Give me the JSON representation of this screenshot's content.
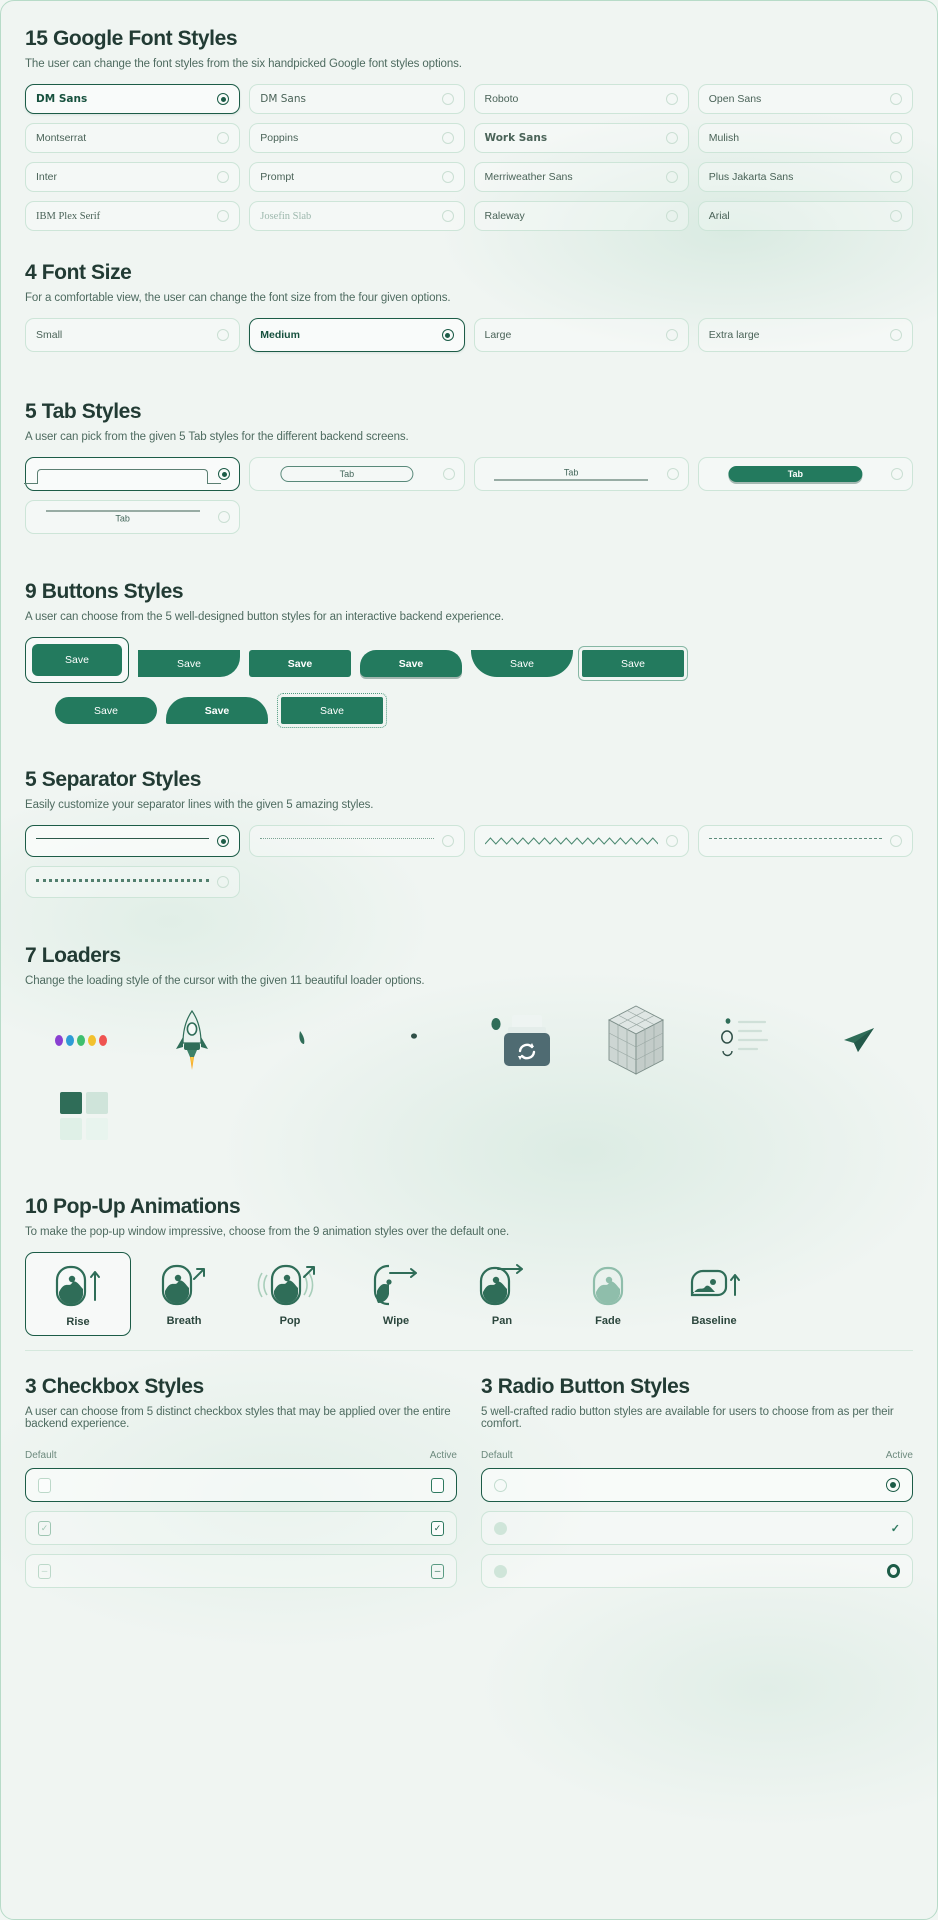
{
  "theme": {
    "accent": "#237a5e",
    "accent_dark": "#1c5c47",
    "bg": "#f0f5f2",
    "text": "#223b34"
  },
  "sections": {
    "fonts": {
      "title": "15 Google Font Styles",
      "subtitle": "The user can change the font styles from the six handpicked Google font styles options.",
      "options": [
        {
          "label": "DM Sans",
          "selected": true
        },
        {
          "label": "DM Sans",
          "selected": false
        },
        {
          "label": "Roboto",
          "selected": false
        },
        {
          "label": "Open Sans",
          "selected": false
        },
        {
          "label": "Montserrat",
          "selected": false
        },
        {
          "label": "Poppins",
          "selected": false
        },
        {
          "label": "Work Sans",
          "selected": false
        },
        {
          "label": "Mulish",
          "selected": false
        },
        {
          "label": "Inter",
          "selected": false
        },
        {
          "label": "Prompt",
          "selected": false
        },
        {
          "label": "Merriweather Sans",
          "selected": false
        },
        {
          "label": "Plus Jakarta Sans",
          "selected": false
        },
        {
          "label": "IBM Plex Serif",
          "selected": false
        },
        {
          "label": "Josefin Slab",
          "selected": false
        },
        {
          "label": "Raleway",
          "selected": false
        },
        {
          "label": "Arial",
          "selected": false
        }
      ]
    },
    "font_size": {
      "title": "4 Font Size",
      "subtitle": "For a comfortable view, the user can change the font size from the four given options.",
      "options": [
        {
          "label": "Small",
          "selected": false
        },
        {
          "label": "Medium",
          "selected": true
        },
        {
          "label": "Large",
          "selected": false
        },
        {
          "label": "Extra large",
          "selected": false
        }
      ]
    },
    "tabs": {
      "title": "5 Tab Styles",
      "subtitle": "A user can pick from the given 5 Tab styles for the different backend screens.",
      "options": [
        {
          "label": "",
          "style": "shape",
          "selected": true
        },
        {
          "label": "Tab",
          "style": "pill-outline",
          "selected": false
        },
        {
          "label": "Tab",
          "style": "underline",
          "selected": false
        },
        {
          "label": "Tab",
          "style": "pill-filled",
          "selected": false
        },
        {
          "label": "Tab",
          "style": "overline",
          "selected": false
        }
      ]
    },
    "buttons": {
      "title": "9 Buttons Styles",
      "subtitle": "A user can choose from the 5 well-designed button styles for an interactive backend experience.",
      "label": "Save",
      "options": [
        {
          "label": "Save",
          "style": "rounded",
          "selected": true
        },
        {
          "label": "Save",
          "style": "leaf-right-bottom",
          "selected": false
        },
        {
          "label": "Save",
          "style": "square-bold",
          "selected": false
        },
        {
          "label": "Save",
          "style": "pill-top",
          "selected": false
        },
        {
          "label": "Save",
          "style": "bowl",
          "selected": false
        },
        {
          "label": "Save",
          "style": "outline-offset",
          "selected": false
        },
        {
          "label": "Save",
          "style": "pill",
          "selected": false
        },
        {
          "label": "Save",
          "style": "arch",
          "selected": false
        },
        {
          "label": "Save",
          "style": "dotted-offset",
          "selected": false
        }
      ]
    },
    "separators": {
      "title": "5 Separator Styles",
      "subtitle": "Easily customize your separator lines with the given 5 amazing styles.",
      "options": [
        {
          "style": "solid",
          "selected": true
        },
        {
          "style": "dotted",
          "selected": false
        },
        {
          "style": "zigzag",
          "selected": false
        },
        {
          "style": "dashed",
          "selected": false
        },
        {
          "style": "thick-dotted",
          "selected": false
        }
      ]
    },
    "loaders": {
      "title": "7 Loaders",
      "subtitle": "Change the loading style of the cursor with the given 11 beautiful loader options.",
      "options": [
        {
          "icon": "dots-loader",
          "colors": [
            "#8a3fd1",
            "#2e9bd6",
            "#3fbf6f",
            "#f2c12e",
            "#ef5350"
          ]
        },
        {
          "icon": "rocket-loader"
        },
        {
          "icon": "comet-loader"
        },
        {
          "icon": "dot-loader"
        },
        {
          "icon": "printer-refresh-loader"
        },
        {
          "icon": "cube-loader"
        },
        {
          "icon": "typing-lines-loader"
        },
        {
          "icon": "paper-plane-loader"
        },
        {
          "icon": "squares-loader"
        }
      ]
    },
    "popups": {
      "title": "10 Pop-Up Animations",
      "subtitle": "To make the pop-up window impressive, choose from the 9 animation styles over the default one.",
      "options": [
        {
          "label": "Rise",
          "icon": "popup-rise-icon",
          "selected": true
        },
        {
          "label": "Breath",
          "icon": "popup-breath-icon",
          "selected": false
        },
        {
          "label": "Pop",
          "icon": "popup-pop-icon",
          "selected": false
        },
        {
          "label": "Wipe",
          "icon": "popup-wipe-icon",
          "selected": false
        },
        {
          "label": "Pan",
          "icon": "popup-pan-icon",
          "selected": false
        },
        {
          "label": "Fade",
          "icon": "popup-fade-icon",
          "selected": false
        },
        {
          "label": "Baseline",
          "icon": "popup-baseline-icon",
          "selected": false
        }
      ]
    },
    "checkboxes": {
      "title": "3 Checkbox Styles",
      "subtitle": "A user can choose from 5 distinct checkbox styles that may be applied over the entire backend experience.",
      "col_default": "Default",
      "col_active": "Active",
      "rows": [
        {
          "default_style": "empty-square",
          "active_style": "empty-square-accent",
          "selected": true
        },
        {
          "default_style": "check-muted",
          "active_style": "check-accent",
          "selected": false
        },
        {
          "default_style": "dash-muted",
          "active_style": "dash-accent",
          "selected": false
        }
      ]
    },
    "radios": {
      "title": "3 Radio Button Styles",
      "subtitle": "5 well-crafted radio button styles are available for users to choose from as per their comfort.",
      "col_default": "Default",
      "col_active": "Active",
      "rows": [
        {
          "default_style": "empty-circle",
          "active_style": "dot-circle",
          "selected": true
        },
        {
          "default_style": "filled-circle",
          "active_style": "tick",
          "selected": false
        },
        {
          "default_style": "filled-circle",
          "active_style": "ring",
          "selected": false
        }
      ]
    }
  }
}
